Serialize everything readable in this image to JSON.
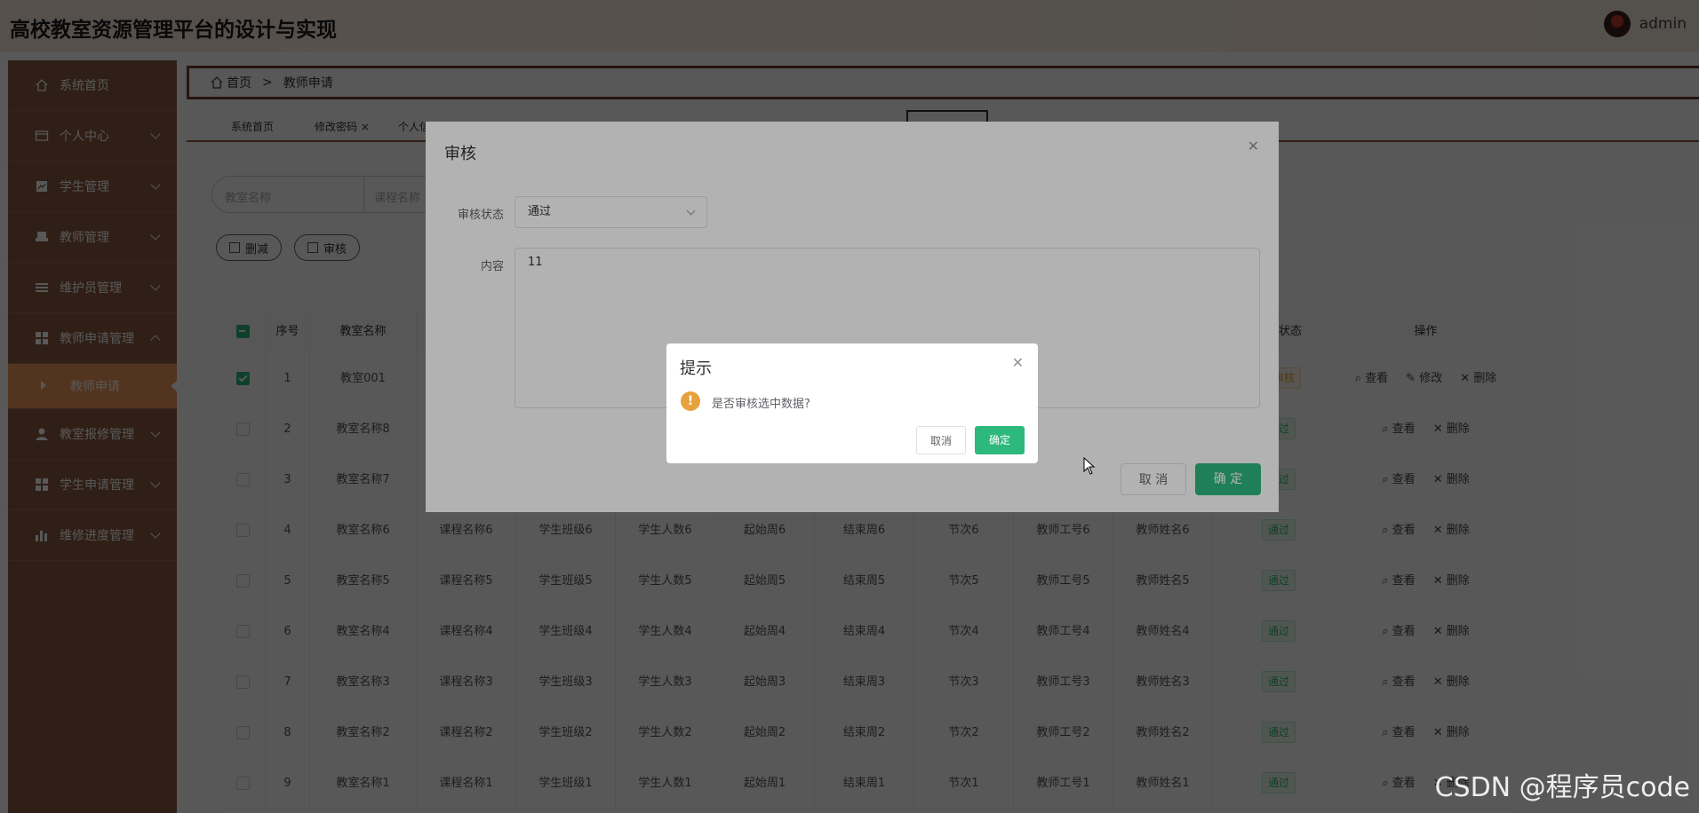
{
  "header": {
    "title": "高校教室资源管理平台的设计与实现",
    "user": "admin"
  },
  "sidebar": {
    "items": [
      {
        "label": "系统首页",
        "icon": "home-icon"
      },
      {
        "label": "个人中心",
        "icon": "card-icon"
      },
      {
        "label": "学生管理",
        "icon": "chart-icon"
      },
      {
        "label": "教师管理",
        "icon": "printer-icon"
      },
      {
        "label": "维护员管理",
        "icon": "list-icon"
      },
      {
        "label": "教师申请管理",
        "icon": "grid-icon"
      },
      {
        "label": "教师申请",
        "icon": ""
      },
      {
        "label": "教室报修管理",
        "icon": "user-icon"
      },
      {
        "label": "学生申请管理",
        "icon": "grid-icon"
      },
      {
        "label": "维修进度管理",
        "icon": "bar-icon"
      }
    ]
  },
  "breadcrumb": {
    "home": "首页",
    "current": "教师申请"
  },
  "tabs": [
    "系统首页",
    "修改密码",
    "个人信"
  ],
  "search": {
    "classroom_placeholder": "教室名称",
    "course_placeholder": "课程名称"
  },
  "buttons": {
    "delete": "删减",
    "audit": "审核"
  },
  "table": {
    "headers": {
      "index": "序号",
      "classroom": "教室名称",
      "status": "审核状态",
      "actions": "操作"
    },
    "action_view": "查看",
    "action_edit": "修改",
    "action_delete": "删除",
    "rows": [
      {
        "idx": "1",
        "classroom": "教室001",
        "course": "",
        "cls": "",
        "count": "",
        "start": "",
        "end": "",
        "period": "",
        "tid": "",
        "tname": "",
        "status": "待审核",
        "checked": true
      },
      {
        "idx": "2",
        "classroom": "教室名称8",
        "course": "",
        "cls": "",
        "count": "",
        "start": "",
        "end": "",
        "period": "",
        "tid": "",
        "tname": "",
        "status": "通过",
        "checked": false
      },
      {
        "idx": "3",
        "classroom": "教室名称7",
        "course": "",
        "cls": "",
        "count": "",
        "start": "",
        "end": "",
        "period": "",
        "tid": "",
        "tname": "",
        "status": "通过",
        "checked": false
      },
      {
        "idx": "4",
        "classroom": "教室名称6",
        "course": "课程名称6",
        "cls": "学生班级6",
        "count": "学生人数6",
        "start": "起始周6",
        "end": "结束周6",
        "period": "节次6",
        "tid": "教师工号6",
        "tname": "教师姓名6",
        "status": "通过",
        "checked": false
      },
      {
        "idx": "5",
        "classroom": "教室名称5",
        "course": "课程名称5",
        "cls": "学生班级5",
        "count": "学生人数5",
        "start": "起始周5",
        "end": "结束周5",
        "period": "节次5",
        "tid": "教师工号5",
        "tname": "教师姓名5",
        "status": "通过",
        "checked": false
      },
      {
        "idx": "6",
        "classroom": "教室名称4",
        "course": "课程名称4",
        "cls": "学生班级4",
        "count": "学生人数4",
        "start": "起始周4",
        "end": "结束周4",
        "period": "节次4",
        "tid": "教师工号4",
        "tname": "教师姓名4",
        "status": "通过",
        "checked": false
      },
      {
        "idx": "7",
        "classroom": "教室名称3",
        "course": "课程名称3",
        "cls": "学生班级3",
        "count": "学生人数3",
        "start": "起始周3",
        "end": "结束周3",
        "period": "节次3",
        "tid": "教师工号3",
        "tname": "教师姓名3",
        "status": "通过",
        "checked": false
      },
      {
        "idx": "8",
        "classroom": "教室名称2",
        "course": "课程名称2",
        "cls": "学生班级2",
        "count": "学生人数2",
        "start": "起始周2",
        "end": "结束周2",
        "period": "节次2",
        "tid": "教师工号2",
        "tname": "教师姓名2",
        "status": "通过",
        "checked": false
      },
      {
        "idx": "9",
        "classroom": "教室名称1",
        "course": "课程名称1",
        "cls": "学生班级1",
        "count": "学生人数1",
        "start": "起始周1",
        "end": "结束周1",
        "period": "节次1",
        "tid": "教师工号1",
        "tname": "教师姓名1",
        "status": "通过",
        "checked": false
      }
    ]
  },
  "audit_dialog": {
    "title": "审核",
    "status_label": "审核状态",
    "status_value": "通过",
    "content_label": "内容",
    "content_value": "11",
    "cancel": "取 消",
    "ok": "确 定"
  },
  "confirm_dialog": {
    "title": "提示",
    "message": "是否审核选中数据?",
    "cancel": "取消",
    "ok": "确定"
  },
  "watermark": "CSDN @程序员code",
  "colors": {
    "sidebar": "#8a5a40",
    "accent": "#2db87d",
    "submenu": "#f0965a"
  }
}
